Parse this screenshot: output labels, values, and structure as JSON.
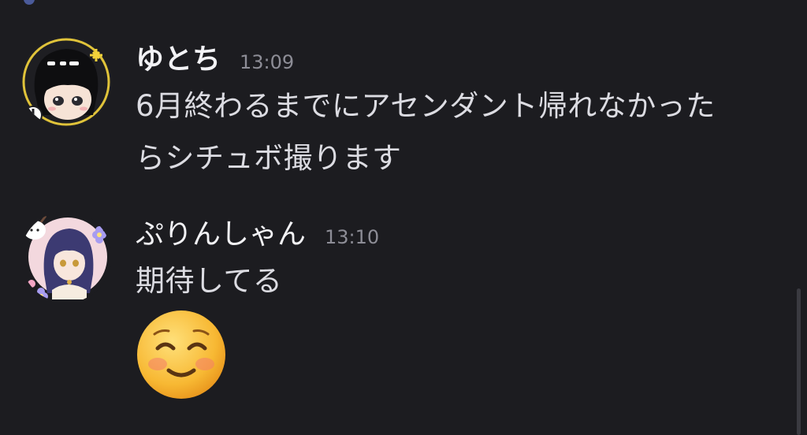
{
  "messages": [
    {
      "username": "ゆとち",
      "timestamp": "13:09",
      "lines": [
        "6月終わるまでにアセンダント帰れなかった",
        "らシチュボ撮ります"
      ],
      "avatar_icon": "avatar-anime-girl-black-hair"
    },
    {
      "username": "ぷりんしゃん",
      "timestamp": "13:10",
      "lines": [
        "期待してる"
      ],
      "avatar_icon": "avatar-anime-girl-purple-hair",
      "emoji": "smiling-face-with-smiling-eyes"
    }
  ]
}
